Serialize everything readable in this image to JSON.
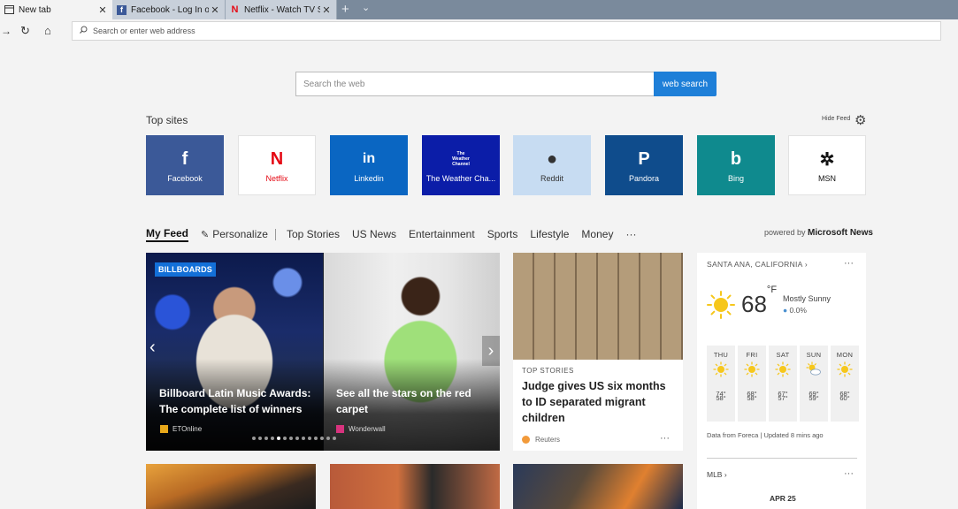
{
  "tabs": [
    {
      "label": "New tab",
      "active": true,
      "icon": "newtab-icon"
    },
    {
      "label": "Facebook - Log In or Sign Up",
      "active": false,
      "icon": "facebook-icon"
    },
    {
      "label": "Netflix - Watch TV Shows Online",
      "active": false,
      "icon": "netflix-icon"
    }
  ],
  "tab_close": "✕",
  "new_tab_glyph": "+",
  "tab_menu_glyph": "⌄",
  "nav": {
    "refresh_glyph": "↻",
    "home_glyph": "⌂",
    "back_glyph": "→"
  },
  "address": {
    "placeholder": "Search or enter web address"
  },
  "search": {
    "placeholder": "Search the web",
    "button": "web search"
  },
  "topsites": {
    "title": "Top sites",
    "hide_feed": "Hide Feed",
    "items": [
      {
        "label": "Facebook",
        "glyph": "f",
        "bg": "#3b5998",
        "fg": "#ffffff"
      },
      {
        "label": "Netflix",
        "glyph": "N",
        "bg": "#ffffff",
        "fg": "#e50914"
      },
      {
        "label": "Linkedin",
        "glyph": "in",
        "bg": "#0a66c2",
        "fg": "#ffffff"
      },
      {
        "label": "The Weather Cha...",
        "glyph": "The Weather Channel",
        "bg": "#0b1da8",
        "fg": "#ffffff"
      },
      {
        "label": "Reddit",
        "glyph": "●",
        "bg": "#c7dcf2",
        "fg": "#333333"
      },
      {
        "label": "Pandora",
        "glyph": "P",
        "bg": "#0f4c8c",
        "fg": "#ffffff"
      },
      {
        "label": "Bing",
        "glyph": "b",
        "bg": "#0f8a8e",
        "fg": "#ffffff"
      },
      {
        "label": "MSN",
        "glyph": "✲",
        "bg": "#ffffff",
        "fg": "#111111"
      }
    ]
  },
  "feednav": {
    "items": [
      "My Feed",
      "Personalize",
      "Top Stories",
      "US News",
      "Entertainment",
      "Sports",
      "Lifestyle",
      "Money",
      "···"
    ],
    "personalize_glyph": "✎",
    "powered_prefix": "powered by",
    "powered_brand": "Microsoft News"
  },
  "hero": {
    "badge": "BILLBOARDS",
    "slides": [
      {
        "title": "Billboard Latin Music Awards: The complete list of winners",
        "source": "ETOnline"
      },
      {
        "title": "See all the stars on the red carpet",
        "source": "Wonderwall"
      }
    ],
    "left_arrow": "‹",
    "right_arrow": "›",
    "dot_count": 14,
    "active_dot": 4
  },
  "story": {
    "tag": "TOP STORIES",
    "title": "Judge gives US six months to ID separated migrant children",
    "source": "Reuters",
    "more": "···"
  },
  "weather": {
    "location": "SANTA ANA, CALIFORNIA",
    "location_chevron": "›",
    "more": "···",
    "temp": "68",
    "unit": "°F",
    "condition": "Mostly Sunny",
    "precip": "0.0%",
    "drop_glyph": "💧",
    "days": [
      {
        "name": "THU",
        "hi": "74°",
        "lo": "58°",
        "icon": "sun"
      },
      {
        "name": "FRI",
        "hi": "68°",
        "lo": "58°",
        "icon": "sun"
      },
      {
        "name": "SAT",
        "hi": "67°",
        "lo": "57°",
        "icon": "sun"
      },
      {
        "name": "SUN",
        "hi": "69°",
        "lo": "59°",
        "icon": "partly-cloudy"
      },
      {
        "name": "MON",
        "hi": "68°",
        "lo": "60°",
        "icon": "sun"
      }
    ],
    "footer": "Data from Foreca | Updated 8 mins ago",
    "mlb_label": "MLB",
    "mlb_chevron": "›",
    "mlb_date": "APR 25"
  },
  "colors": {
    "accent": "#1e7fd8",
    "badge": "#1370d8"
  }
}
